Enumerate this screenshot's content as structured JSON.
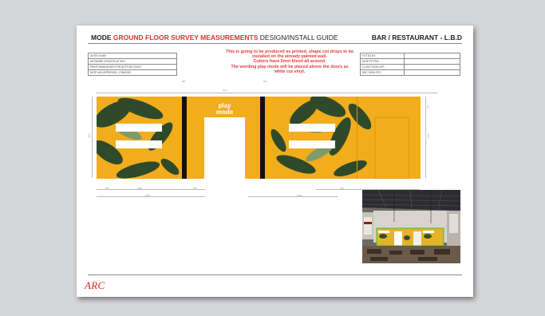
{
  "header": {
    "title_brand": "MODE",
    "title_highlight": "GROUND FLOOR SURVEY MEASUREMENTS",
    "title_suffix": "DESIGN/INSTALL GUIDE",
    "title_right": "BAR / RESTAURANT - L.B.D"
  },
  "info_left": [
    "UNITS IN MM",
    "ARTWORK CREATED AT 50%",
    "PRINT 50MM BLEED FOR BOTTOM, RIGHT",
    "DATE A/W APPROVED: 17/06/2022"
  ],
  "info_right": [
    "FITTED BY:",
    "DATE FITTED:",
    "CLIENT SIGN-OFF:",
    "ARC SIGN-OFF:"
  ],
  "notice_lines": [
    "This is going to be produced as printed, shape cut drops to be",
    "installed on the already painted wall.",
    "Cutters have 2mm bleed all around.",
    "The wording play mode will be placed above the doors as",
    "white cut vinyl."
  ],
  "mural": {
    "opening_text_line1": "play",
    "opening_text_line2": "mode"
  },
  "dimensions": {
    "top_total": "8470",
    "top_left": "860",
    "top_mid": "860",
    "left_height": "2970",
    "right_height1": "350",
    "right_height2": "2600",
    "bottom_a": "550",
    "bottom_b": "1000",
    "bottom_c": "500",
    "bottom_total_left": "3470",
    "bottom_mid": "3000",
    "bottom_right": "780"
  },
  "footer": {
    "logo_text": "ARC"
  },
  "colors": {
    "background": "#d4d5d7",
    "wall_yellow": "#f2ad1c",
    "accent_red": "#e0302c",
    "leaf_green": "#2f4a2a"
  }
}
